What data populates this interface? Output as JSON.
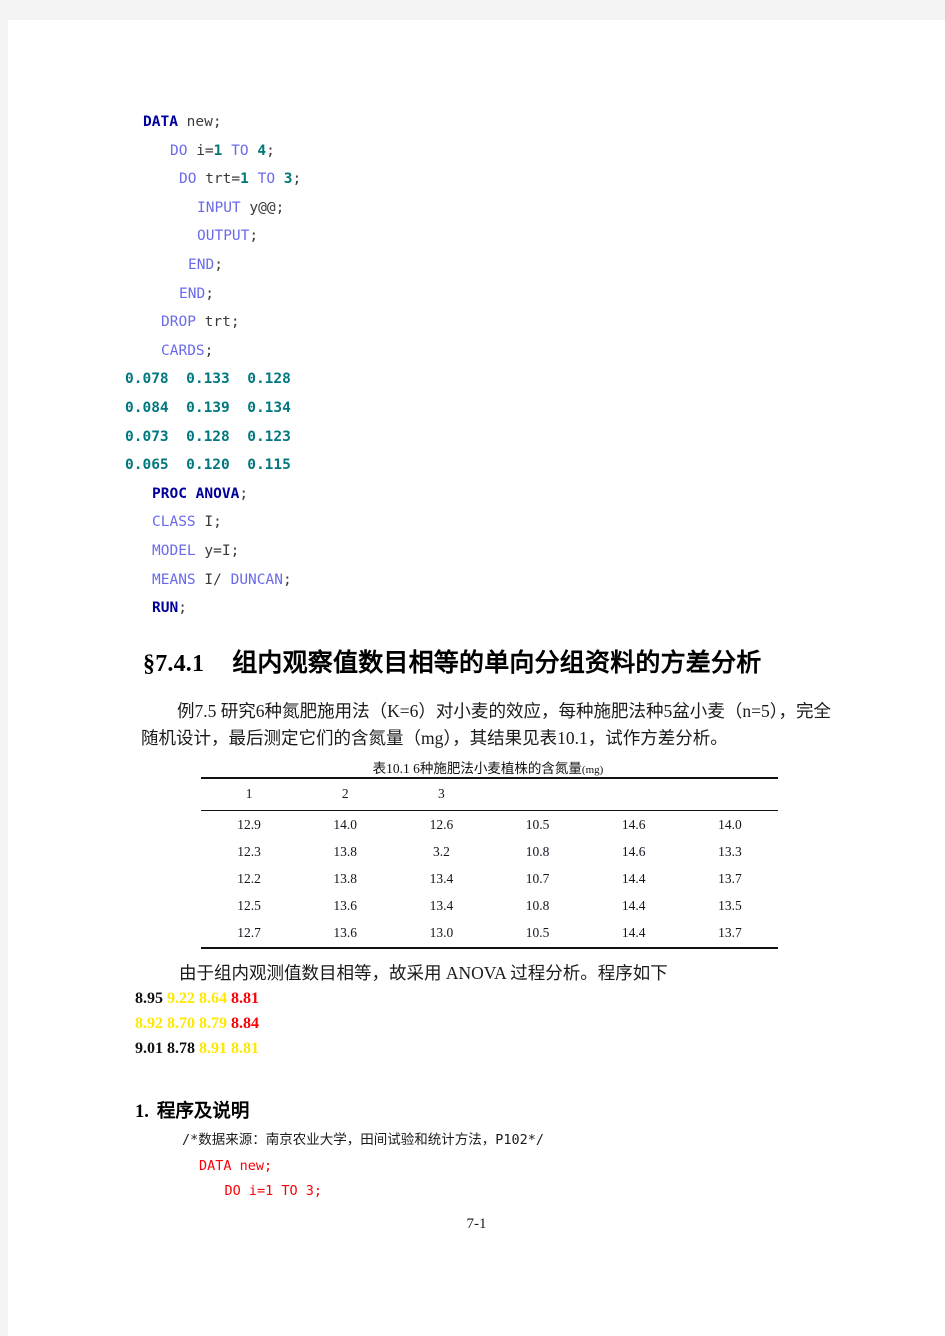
{
  "page": {
    "footer": "7-1"
  },
  "code_top": {
    "lines": [
      {
        "indent": 0,
        "tokens": [
          {
            "t": "DATA",
            "s": "kw-bold"
          },
          {
            "t": " new;",
            "s": "plain"
          }
        ]
      },
      {
        "indent": 3,
        "tokens": [
          {
            "t": "DO",
            "s": "kw"
          },
          {
            "t": " i=",
            "s": "plain"
          },
          {
            "t": "1",
            "s": "num-bold"
          },
          {
            "t": " ",
            "s": "plain"
          },
          {
            "t": "TO",
            "s": "kw"
          },
          {
            "t": " ",
            "s": "plain"
          },
          {
            "t": "4",
            "s": "num-bold"
          },
          {
            "t": ";",
            "s": "plain"
          }
        ]
      },
      {
        "indent": 4,
        "tokens": [
          {
            "t": "DO",
            "s": "kw"
          },
          {
            "t": " trt=",
            "s": "plain"
          },
          {
            "t": "1",
            "s": "num-bold"
          },
          {
            "t": " ",
            "s": "plain"
          },
          {
            "t": "TO",
            "s": "kw"
          },
          {
            "t": " ",
            "s": "plain"
          },
          {
            "t": "3",
            "s": "num-bold"
          },
          {
            "t": ";",
            "s": "plain"
          }
        ]
      },
      {
        "indent": 6,
        "tokens": [
          {
            "t": "INPUT",
            "s": "kw"
          },
          {
            "t": " y@@;",
            "s": "plain"
          }
        ]
      },
      {
        "indent": 6,
        "tokens": [
          {
            "t": "OUTPUT",
            "s": "kw"
          },
          {
            "t": ";",
            "s": "plain"
          }
        ]
      },
      {
        "indent": 5,
        "tokens": [
          {
            "t": "END",
            "s": "kw"
          },
          {
            "t": ";",
            "s": "plain"
          }
        ]
      },
      {
        "indent": 4,
        "tokens": [
          {
            "t": "END",
            "s": "kw"
          },
          {
            "t": ";",
            "s": "plain"
          }
        ]
      },
      {
        "indent": 2,
        "tokens": [
          {
            "t": "DROP",
            "s": "kw"
          },
          {
            "t": " trt;",
            "s": "plain"
          }
        ]
      },
      {
        "indent": 2,
        "tokens": [
          {
            "t": "CARDS",
            "s": "kw"
          },
          {
            "t": ";",
            "s": "plain"
          }
        ]
      },
      {
        "indent": -1,
        "tokens": [
          {
            "t": "0.078  0.133  0.128",
            "s": "dataval"
          }
        ]
      },
      {
        "indent": -1,
        "tokens": [
          {
            "t": "0.084  0.139  0.134",
            "s": "dataval"
          }
        ]
      },
      {
        "indent": -1,
        "tokens": [
          {
            "t": "0.073  0.128  0.123",
            "s": "dataval"
          }
        ]
      },
      {
        "indent": -1,
        "tokens": [
          {
            "t": "0.065  0.120  0.115",
            "s": "dataval"
          }
        ]
      },
      {
        "indent": 1,
        "tokens": [
          {
            "t": "PROC ANOVA",
            "s": "kw-bold"
          },
          {
            "t": ";",
            "s": "plain"
          }
        ]
      },
      {
        "indent": 1,
        "tokens": [
          {
            "t": "CLASS",
            "s": "kw"
          },
          {
            "t": " I;",
            "s": "plain"
          }
        ]
      },
      {
        "indent": 1,
        "tokens": [
          {
            "t": "MODEL",
            "s": "kw"
          },
          {
            "t": " y=I;",
            "s": "plain"
          }
        ]
      },
      {
        "indent": 1,
        "tokens": [
          {
            "t": "MEANS",
            "s": "kw"
          },
          {
            "t": " I/",
            "s": "plain"
          },
          {
            "t": " DUNCAN",
            "s": "kw"
          },
          {
            "t": ";",
            "s": "plain"
          }
        ]
      },
      {
        "indent": 1,
        "tokens": [
          {
            "t": "RUN",
            "s": "kw-bold"
          },
          {
            "t": ";",
            "s": "plain"
          }
        ]
      }
    ]
  },
  "section": {
    "number": "§7.4.1",
    "title": "组内观察值数目相等的单向分组资料的方差分析"
  },
  "paragraph": {
    "text": "例7.5  研究6种氮肥施用法（K=6）对小麦的效应，每种施肥法种5盆小麦（n=5），完全随机设计，最后测定它们的含氮量（mg），其结果见表10.1，试作方差分析。"
  },
  "table": {
    "caption_main": "表10.1  6种施肥法小麦植株的含氮量",
    "caption_unit": "(mg)",
    "headers": [
      "1",
      "2",
      "3",
      "",
      "",
      ""
    ],
    "rows": [
      [
        "12.9",
        "14.0",
        "12.6",
        "10.5",
        "14.6",
        "14.0"
      ],
      [
        "12.3",
        "13.8",
        "3.2",
        "10.8",
        "14.6",
        "13.3"
      ],
      [
        "12.2",
        "13.8",
        "13.4",
        "10.7",
        "14.4",
        "13.7"
      ],
      [
        "12.5",
        "13.6",
        "13.4",
        "10.8",
        "14.4",
        "13.5"
      ],
      [
        "12.7",
        "13.6",
        "13.0",
        "10.5",
        "14.4",
        "13.7"
      ]
    ]
  },
  "explain": {
    "text": "由于组内观测值数目相等，故采用 ANOVA 过程分析。程序如下"
  },
  "color_numbers": {
    "rows": [
      [
        {
          "t": "8.95",
          "c": "c-black"
        },
        {
          "t": "9.22",
          "c": "c-yellow"
        },
        {
          "t": "8.64",
          "c": "c-yellow"
        },
        {
          "t": "8.81",
          "c": "c-red"
        }
      ],
      [
        {
          "t": "8.92",
          "c": "c-yellow"
        },
        {
          "t": "8.70",
          "c": "c-yellow"
        },
        {
          "t": "8.79",
          "c": "c-yellow"
        },
        {
          "t": "8.84",
          "c": "c-red"
        }
      ],
      [
        {
          "t": "9.01",
          "c": "c-black"
        },
        {
          "t": "8.78",
          "c": "c-black"
        },
        {
          "t": "8.91",
          "c": "c-yellow"
        },
        {
          "t": "8.81",
          "c": "c-yellow"
        }
      ]
    ]
  },
  "numbered_heading": {
    "number": "1",
    "dot": ".",
    "title": "程序及说明"
  },
  "code_bottom": {
    "lines": [
      {
        "indent": 0,
        "text": "/*数据来源：南京农业大学，田间试验和统计方法，P102*/",
        "s": "cmt"
      },
      {
        "indent": 2,
        "text": "DATA new;",
        "s": "red-code"
      },
      {
        "indent": 5,
        "text": "DO i=1 TO 3;",
        "s": "red-code"
      }
    ]
  },
  "colors": {
    "keyword_bold": "#00009a",
    "keyword": "#6a6aea",
    "data_value": "#00787e",
    "red_code": "#fb0007",
    "yellow": "#ffe800",
    "page_bg": "#ffffff",
    "margin_bg": "#f4f4f4"
  }
}
